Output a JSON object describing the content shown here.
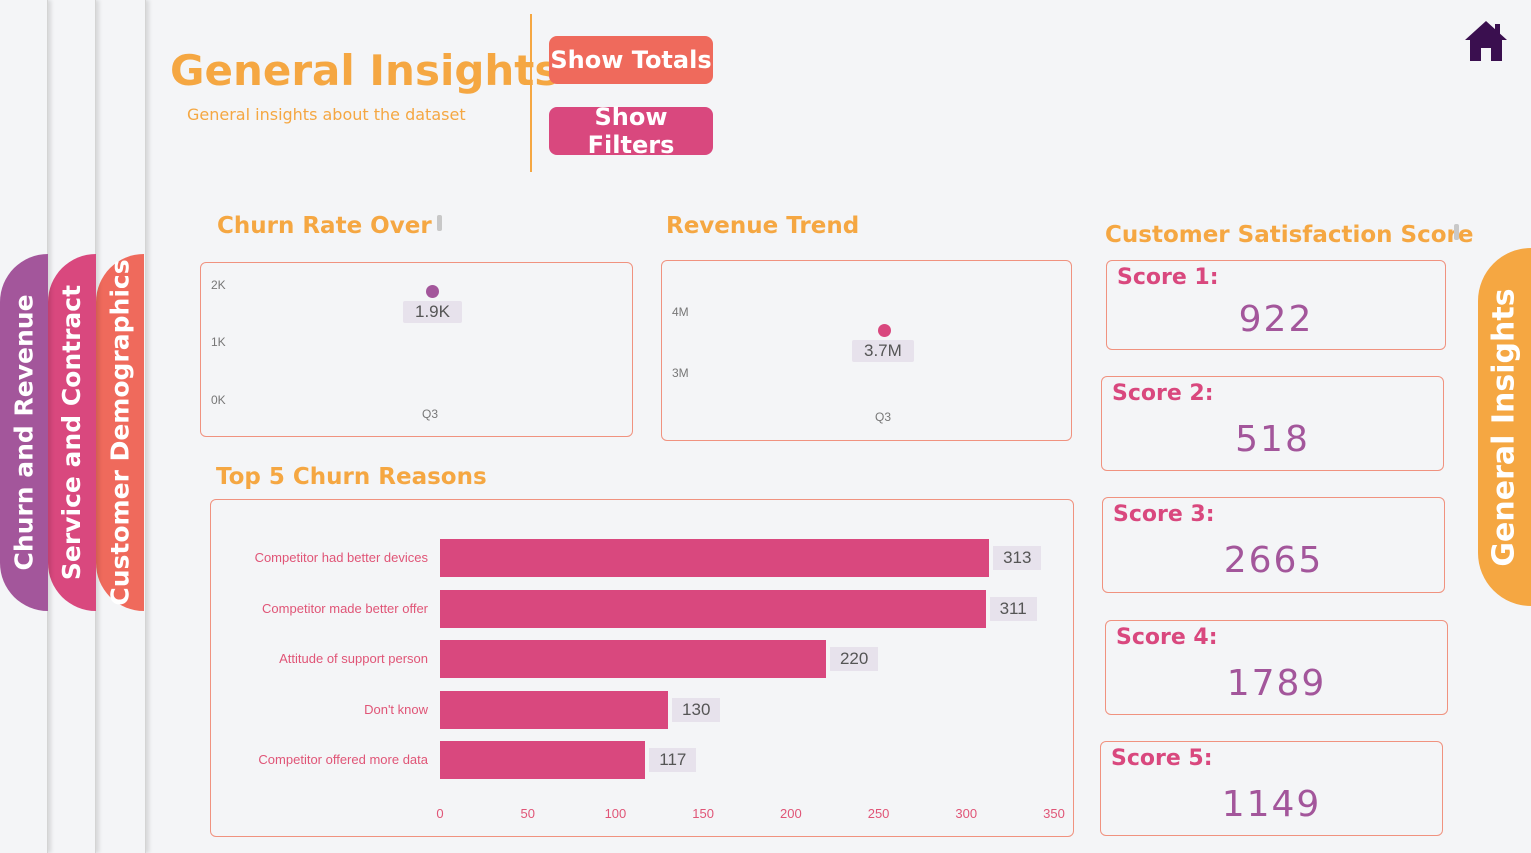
{
  "nav": {
    "tabs": [
      {
        "label": "Churn and Revenue",
        "color": "#a3569b"
      },
      {
        "label": "Service and Contract",
        "color": "#d9487e"
      },
      {
        "label": "Customer Demographics",
        "color": "#ef6a5c"
      }
    ],
    "active_tab": "General Insights"
  },
  "header": {
    "title": "General Insights",
    "subtitle": "General insights about the dataset",
    "show_totals_label": "Show Totals",
    "show_filters_label": "Show Filters",
    "home_icon": "home-icon"
  },
  "churn_rate": {
    "title": "Churn Rate Over",
    "y_ticks": [
      "2K",
      "1K",
      "0K"
    ],
    "x_label": "Q3",
    "value_label": "1.9K"
  },
  "revenue": {
    "title": "Revenue Trend",
    "y_ticks": [
      "4M",
      "3M"
    ],
    "x_label": "Q3",
    "value_label": "3.7M"
  },
  "top_reasons": {
    "title": "Top 5 Churn Reasons"
  },
  "satisfaction": {
    "title": "Customer Satisfaction Score",
    "scores": [
      {
        "label": "Score 1:",
        "value": "922"
      },
      {
        "label": "Score 2:",
        "value": "518"
      },
      {
        "label": "Score 3:",
        "value": "2665"
      },
      {
        "label": "Score 4:",
        "value": "1789"
      },
      {
        "label": "Score 5:",
        "value": "1149"
      }
    ]
  },
  "colors": {
    "accent": "#f5a742",
    "bar": "#d9487e",
    "purple": "#a3569b",
    "coral": "#ef6a5c"
  },
  "chart_data": [
    {
      "type": "scatter",
      "title": "Churn Rate Over",
      "categories": [
        "Q3"
      ],
      "values": [
        1900
      ],
      "y_ticks": [
        "0K",
        "1K",
        "2K"
      ],
      "ylim": [
        0,
        2000
      ]
    },
    {
      "type": "scatter",
      "title": "Revenue Trend",
      "categories": [
        "Q3"
      ],
      "values": [
        3700000
      ],
      "y_ticks": [
        "3M",
        "4M"
      ]
    },
    {
      "type": "bar",
      "orientation": "horizontal",
      "title": "Top 5 Churn Reasons",
      "categories": [
        "Competitor had better devices",
        "Competitor made better offer",
        "Attitude of support person",
        "Don't know",
        "Competitor offered more data"
      ],
      "values": [
        313,
        311,
        220,
        130,
        117
      ],
      "x_ticks": [
        0,
        50,
        100,
        150,
        200,
        250,
        300,
        350
      ],
      "xlim": [
        0,
        350
      ]
    }
  ]
}
